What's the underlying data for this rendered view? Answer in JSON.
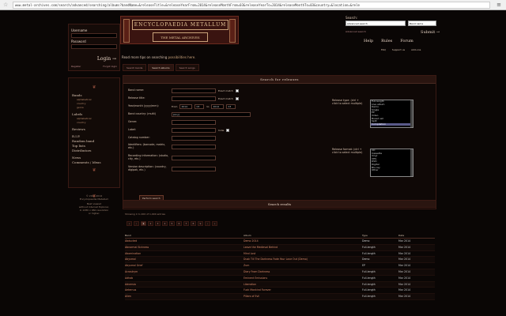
{
  "browser": {
    "url": "www.metal-archives.com/search/advanced/searching/albums?bandName=&releaseTitle=&releaseYearFrom=2014&releaseMonthFrom=03&releaseYearTo=2014&releaseMonthTo=03&country=&location=&rele"
  },
  "sidebar": {
    "username_label": "Username",
    "password_label": "Password",
    "login_label": "Login →",
    "register_label": "Register",
    "forgot_label": "Forgot login",
    "sections": [
      {
        "label": "Bands",
        "items": [
          "alphabetical",
          "country",
          "genre"
        ]
      },
      {
        "label": "Labels",
        "items": [
          "alphabetical",
          "country"
        ]
      },
      {
        "label": "Reviews",
        "items": []
      },
      {
        "label": "R.I.P.",
        "items": []
      },
      {
        "label": "Random band",
        "items": []
      },
      {
        "label": "Top lists",
        "items": []
      },
      {
        "label": "Distributors",
        "items": []
      },
      {
        "label": "News",
        "items": []
      },
      {
        "label": "Comments / Ideas",
        "items": []
      }
    ],
    "footer": [
      "© 2002-2014",
      "Encyclopaedia Metallum",
      "Best viewed",
      "without Internet Explorer,",
      "in 1280 x 960 resolution",
      "or higher."
    ]
  },
  "header": {
    "logo_top": "ENCYCLOPAEDIA METALLUM",
    "logo_bottom": "THE METAL ARCHIVES",
    "tip_text": "Read more tips on searching",
    "tip_link": "possibilities here."
  },
  "search": {
    "label": "Search:",
    "value": "Advanced search",
    "select_value": "Band name",
    "advanced_label": "Advanced search",
    "submit_label": "Submit →"
  },
  "topnav": [
    "Help",
    "Rules",
    "Forum"
  ],
  "subnav": [
    "FAQ",
    "Support us",
    "Add-ons"
  ],
  "tabs": [
    "Search bands",
    "Search albums",
    "Search songs"
  ],
  "form": {
    "title": "Search for releases",
    "band_label": "Band name:",
    "exact_match": "Exact match",
    "release_title_label": "Release title:",
    "year_label": "Year/month (yyyy/mm):",
    "from_label": "From",
    "year_from": "2014",
    "month_from": "03",
    "to_label": "to",
    "year_to": "2014",
    "month_to": "03",
    "country_label": "Band country: (multi)",
    "country_value": "[Any]",
    "genre_label": "Genre:",
    "label_label": "Label:",
    "indie_label": "Indie",
    "catalog_label": "Catalog number:",
    "identifiers_label": "Identifiers: (barcode, matrix, etc.)",
    "recording_label": "Recording information: (studio, city, etc.)",
    "variation_label": "Version description: (country, digipak, etc.)",
    "release_type_label": "Release type: (ctrl + click to select multiple)",
    "release_types": [
      "Full-length",
      "Live album",
      "Demo",
      "Single",
      "EP",
      "Video",
      "Boxed set",
      "Split",
      "Compilation"
    ],
    "release_format_label": "Release format: (ctrl + click to select multiple)",
    "release_formats": [
      "CD",
      "Cassette",
      "Vinyl",
      "VHS",
      "DVD",
      "Digital",
      "Blu-ray",
      "Other"
    ],
    "submit_label": "Perform search"
  },
  "results": {
    "title": "Search results",
    "showing": "Showing 1 to 200 of 1,900 entries",
    "pages": [
      "«",
      "‹",
      "1",
      "2",
      "3",
      "4",
      "5",
      "6",
      "7",
      "8",
      "9",
      "›",
      "»"
    ],
    "columns": [
      "Band",
      "Album",
      "Type",
      "Date"
    ],
    "rows": [
      [
        "Abducted",
        "Demo 2014",
        "Demo",
        "Mar 2014"
      ],
      [
        "Abnormal Sickness",
        "Leave the Medieval Behind",
        "Full-length",
        "Mar 2014"
      ],
      [
        "Abomination",
        "Mind Lost",
        "Full-length",
        "Mar 2014"
      ],
      [
        "Abysmal",
        "Dusk Till The Darkness Fade Your Love Out (Demo)",
        "Demo",
        "Mar 2014"
      ],
      [
        "Abysmal Grief",
        "Zum",
        "EP",
        "Mar 2014"
      ],
      [
        "Acrostrym",
        "Diary From Darkness",
        "Full-length",
        "Mar 2014"
      ],
      [
        "Adhab",
        "Eminent Emissions",
        "Full-length",
        "Mar 2014"
      ],
      [
        "Adversia",
        "Liberation",
        "Full-length",
        "Mar 2014"
      ],
      [
        "Aeternus",
        "Fuck Mankind Forever",
        "Full-length",
        "Mar 2014"
      ],
      [
        "Alien",
        "Pillars of Evil",
        "Full-length",
        "Mar 2014"
      ]
    ]
  }
}
